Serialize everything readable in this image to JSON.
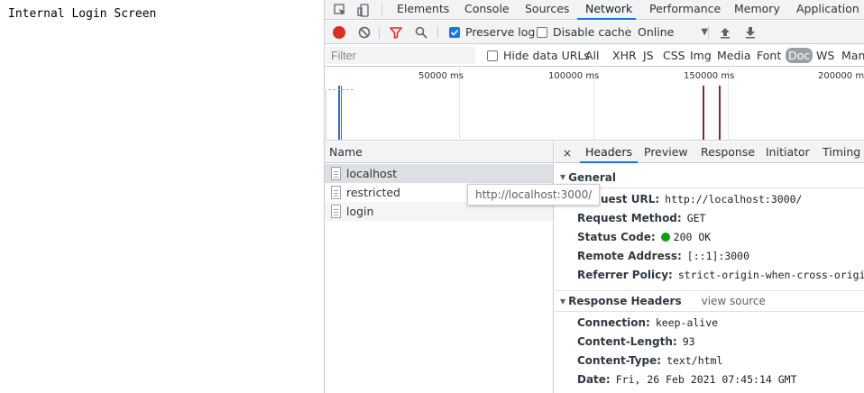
{
  "page": {
    "text": "Internal Login Screen"
  },
  "devtools": {
    "tabs": [
      {
        "label": "Elements"
      },
      {
        "label": "Console"
      },
      {
        "label": "Sources"
      },
      {
        "label": "Network"
      },
      {
        "label": "Performance"
      },
      {
        "label": "Memory"
      },
      {
        "label": "Application"
      }
    ],
    "active_tab": "Network",
    "toolbar": {
      "preserve_log": "Preserve log",
      "disable_cache": "Disable cache",
      "throttle": "Online"
    },
    "filter": {
      "placeholder": "Filter",
      "hide_data_urls": "Hide data URLs",
      "types": [
        "All",
        "XHR",
        "JS",
        "CSS",
        "Img",
        "Media",
        "Font",
        "Doc",
        "WS",
        "Mani"
      ],
      "active_type": "Doc"
    },
    "overview": {
      "ticks": [
        "50000 ms",
        "100000 ms",
        "150000 ms",
        "200000 ms"
      ]
    },
    "requests": {
      "header": "Name",
      "items": [
        {
          "name": "localhost"
        },
        {
          "name": "restricted"
        },
        {
          "name": "login"
        }
      ],
      "tooltip": "http://localhost:3000/"
    },
    "detail": {
      "tabs": [
        "Headers",
        "Preview",
        "Response",
        "Initiator",
        "Timing"
      ],
      "close": "×",
      "general": {
        "title": "General",
        "rows": [
          {
            "key": "Request URL:",
            "value": "http://localhost:3000/"
          },
          {
            "key": "Request Method:",
            "value": "GET"
          },
          {
            "key": "Status Code:",
            "value": "200 OK"
          },
          {
            "key": "Remote Address:",
            "value": "[::1]:3000"
          },
          {
            "key": "Referrer Policy:",
            "value": "strict-origin-when-cross-origin"
          }
        ]
      },
      "response_headers": {
        "title": "Response Headers",
        "view_source": "view source",
        "rows": [
          {
            "key": "Connection:",
            "value": "keep-alive"
          },
          {
            "key": "Content-Length:",
            "value": "93"
          },
          {
            "key": "Content-Type:",
            "value": "text/html"
          },
          {
            "key": "Date:",
            "value": "Fri, 26 Feb 2021 07:45:14 GMT"
          }
        ]
      }
    }
  },
  "colors": {
    "accent": "#1a73e8",
    "record": "#d93025",
    "status_ok": "#0ca20c",
    "bar_blue": "#3367d6",
    "bar_dark_red": "#7f2a3a"
  }
}
